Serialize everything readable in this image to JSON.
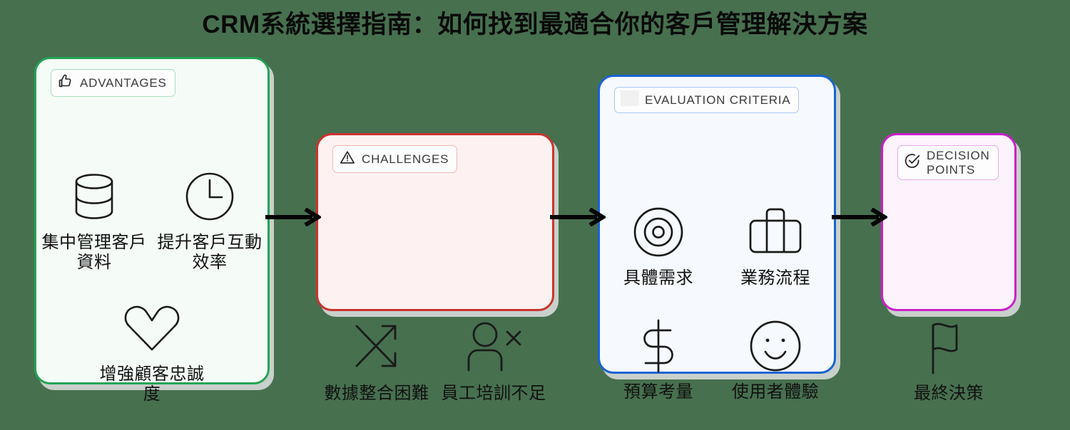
{
  "title": "CRM系統選擇指南：如何找到最適合你的客戶管理解決方案",
  "background_color": "#47704f",
  "cards": [
    {
      "id": "advantages",
      "badge_label": "ADVANTAGES",
      "badge_icon": "thumbs-up-icon",
      "accent_color": "#23a455",
      "fill_color": "#f5fbf7",
      "items": [
        {
          "icon": "database-icon",
          "label": "集中管理客戶資料"
        },
        {
          "icon": "clock-icon",
          "label": "提升客戶互動效率"
        },
        {
          "icon": "heart-icon",
          "label": "增強顧客忠誠度"
        }
      ]
    },
    {
      "id": "challenges",
      "badge_label": "CHALLENGES",
      "badge_icon": "warning-triangle-icon",
      "accent_color": "#cc332e",
      "fill_color": "#fdf2f1",
      "items": [
        {
          "icon": "shuffle-arrows-icon",
          "label": "數據整合困難"
        },
        {
          "icon": "person-remove-icon",
          "label": "員工培訓不足"
        }
      ]
    },
    {
      "id": "evaluation",
      "badge_label": "EVALUATION CRITERIA",
      "badge_icon": "blank-icon",
      "accent_color": "#1864d4",
      "fill_color": "#f6f9fe",
      "items": [
        {
          "icon": "target-icon",
          "label": "具體需求"
        },
        {
          "icon": "briefcase-icon",
          "label": "業務流程"
        },
        {
          "icon": "dollar-sign-icon",
          "label": "預算考量"
        },
        {
          "icon": "smiley-face-icon",
          "label": "使用者體驗"
        }
      ]
    },
    {
      "id": "decision",
      "badge_label": "DECISION\nPOINTS",
      "badge_icon": "check-circle-icon",
      "accent_color": "#cc1ecc",
      "fill_color": "#fcf3fd",
      "items": [
        {
          "icon": "flag-icon",
          "label": "最終決策"
        }
      ]
    }
  ],
  "arrows": [
    {
      "id": "arrow-1",
      "from": "advantages",
      "to": "challenges"
    },
    {
      "id": "arrow-2",
      "from": "challenges",
      "to": "evaluation"
    },
    {
      "id": "arrow-3",
      "from": "evaluation",
      "to": "decision"
    }
  ]
}
